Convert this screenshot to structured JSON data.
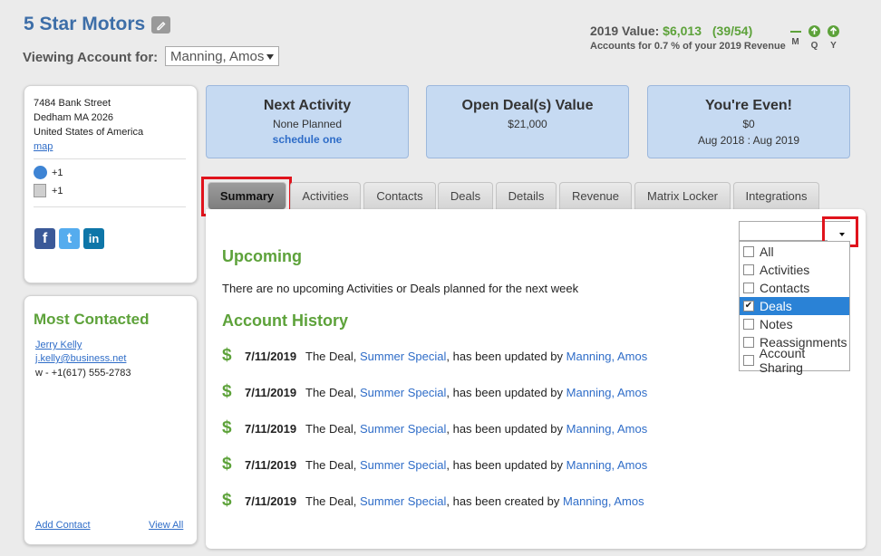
{
  "header": {
    "company": "5 Star Motors",
    "viewing_label": "Viewing Account for:",
    "account_selected": "Manning, Amos",
    "value_label": "2019 Value:",
    "value_amount": "$6,013",
    "value_count": "(39/54)",
    "value_sub": "Accounts for 0.7 % of your 2019 Revenue",
    "trend": [
      {
        "label": "M",
        "state": "flat"
      },
      {
        "label": "Q",
        "state": "up"
      },
      {
        "label": "Y",
        "state": "up"
      }
    ]
  },
  "address": {
    "street": "7484 Bank Street",
    "city": "Dedham MA 2026",
    "country": "United States of America",
    "map_link": "map",
    "phone": "+1",
    "fax": "+1"
  },
  "social": [
    {
      "name": "facebook-icon",
      "glyph": "f",
      "color": "#3b5998"
    },
    {
      "name": "twitter-icon",
      "glyph": "t",
      "color": "#55acee"
    },
    {
      "name": "linkedin-icon",
      "glyph": "in",
      "color": "#0e76a8"
    }
  ],
  "most_contacted": {
    "title": "Most Contacted",
    "name": "Jerry Kelly",
    "email": "j.kelly@business.net",
    "phone": "w - +1(617) 555-2783",
    "add_link": "Add Contact",
    "view_all_link": "View All"
  },
  "stats": [
    {
      "title": "Next Activity",
      "line1": "None Planned",
      "line2": "schedule one"
    },
    {
      "title": "Open Deal(s) Value",
      "line1": "$21,000",
      "line2": ""
    },
    {
      "title": "You're Even!",
      "line1": "$0",
      "line2": "Aug 2018 : Aug 2019"
    }
  ],
  "tabs": [
    "Summary",
    "Activities",
    "Contacts",
    "Deals",
    "Details",
    "Revenue",
    "Matrix Locker",
    "Integrations"
  ],
  "upcoming": {
    "title": "Upcoming",
    "text": "There are no upcoming Activities or Deals planned for the next week"
  },
  "history": {
    "title": "Account History",
    "rows": [
      {
        "icon": "dollar-icon",
        "date": "7/11/2019",
        "prefix": "The Deal, ",
        "deal": "Summer Special",
        "middle": ", has been updated by ",
        "user": "Manning, Amos"
      },
      {
        "icon": "dollar-icon",
        "date": "7/11/2019",
        "prefix": "The Deal, ",
        "deal": "Summer Special",
        "middle": ", has been updated by ",
        "user": "Manning, Amos"
      },
      {
        "icon": "dollar-icon",
        "date": "7/11/2019",
        "prefix": "The Deal, ",
        "deal": "Summer Special",
        "middle": ", has been updated by ",
        "user": "Manning, Amos"
      },
      {
        "icon": "dollar-icon",
        "date": "7/11/2019",
        "prefix": "The Deal, ",
        "deal": "Summer Special",
        "middle": ", has been updated by ",
        "user": "Manning, Amos"
      },
      {
        "icon": "dollar-icon",
        "date": "7/11/2019",
        "prefix": "The Deal, ",
        "deal": "Summer Special",
        "middle": ", has been created by ",
        "user": "Manning, Amos"
      }
    ]
  },
  "filter": {
    "value": "",
    "options": [
      {
        "label": "All",
        "checked": false,
        "selected": false
      },
      {
        "label": "Activities",
        "checked": false,
        "selected": false
      },
      {
        "label": "Contacts",
        "checked": false,
        "selected": false
      },
      {
        "label": "Deals",
        "checked": true,
        "selected": true
      },
      {
        "label": "Notes",
        "checked": false,
        "selected": false
      },
      {
        "label": "Reassignments",
        "checked": false,
        "selected": false
      },
      {
        "label": "Account Sharing",
        "checked": false,
        "selected": false
      }
    ]
  },
  "colors": {
    "green": "#5da23a",
    "link": "#2f6dc8",
    "brand": "#3d6ea8",
    "stat_bg": "#c6daf2",
    "highlight": "#e0131c",
    "selection": "#2a82d6"
  }
}
